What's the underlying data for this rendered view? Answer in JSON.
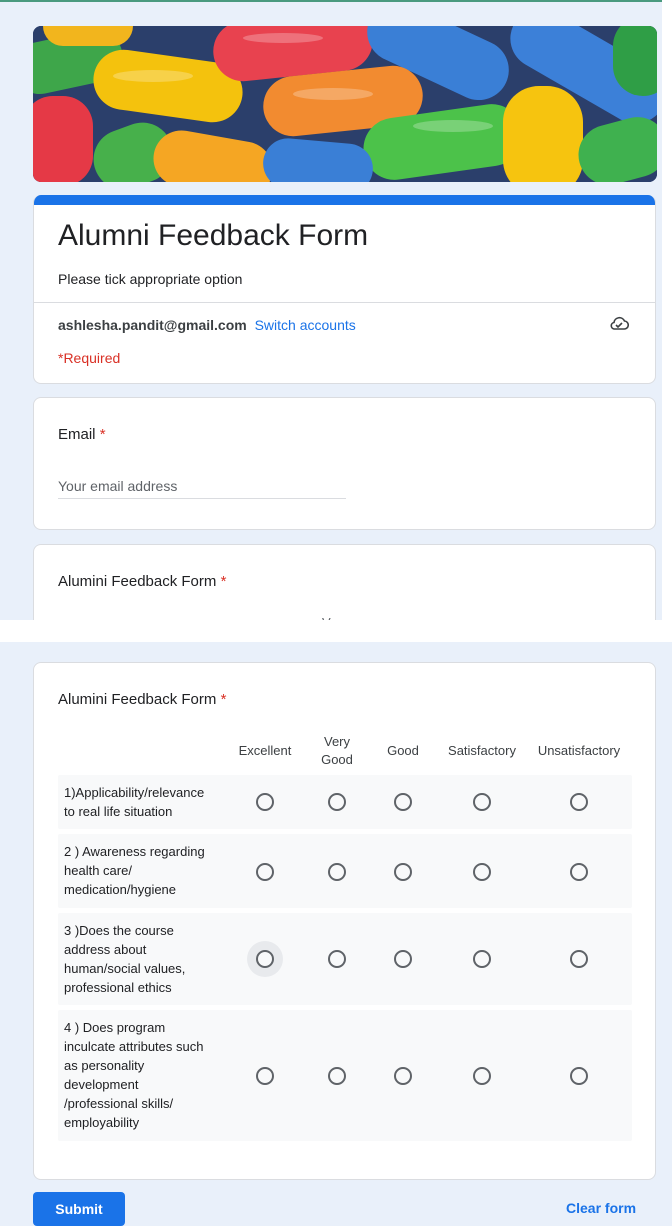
{
  "colors": {
    "accent": "#1a73e8",
    "required": "#d93025",
    "page_bg": "#e9f0fa"
  },
  "header": {
    "title": "Alumni Feedback Form",
    "description": "Please tick appropriate option",
    "account_email": "ashlesha.pandit@gmail.com",
    "switch_accounts": "Switch accounts",
    "cloud_icon": "cloud-saved-icon",
    "required_note": "*Required"
  },
  "email_question": {
    "label": "Email",
    "required_mark": "*",
    "placeholder": "Your email address"
  },
  "scrolled_section": {
    "label": "Alumini Feedback Form",
    "required_mark": "*",
    "cut_column_text": "Very"
  },
  "grid": {
    "label": "Alumini Feedback Form",
    "required_mark": "*",
    "columns": [
      {
        "top": "",
        "bottom": "Excellent"
      },
      {
        "top": "Very",
        "bottom": "Good"
      },
      {
        "top": "",
        "bottom": "Good"
      },
      {
        "top": "",
        "bottom": "Satisfactory"
      },
      {
        "top": "",
        "bottom": "Unsatisfactory"
      }
    ],
    "rows": [
      {
        "lines": [
          "1)Applicability/relevance",
          "to real life situation"
        ]
      },
      {
        "lines": [
          "2 ) Awareness regarding",
          "health care/",
          "medication/hygiene"
        ]
      },
      {
        "lines": [
          "3 )Does the course",
          "address about",
          "human/social values,",
          "professional ethics"
        ]
      },
      {
        "lines": [
          "4 ) Does program",
          "inculcate attributes such",
          "as personality",
          "development",
          "/professional skills/",
          "employability"
        ]
      }
    ]
  },
  "actions": {
    "submit": "Submit",
    "clear": "Clear form"
  }
}
